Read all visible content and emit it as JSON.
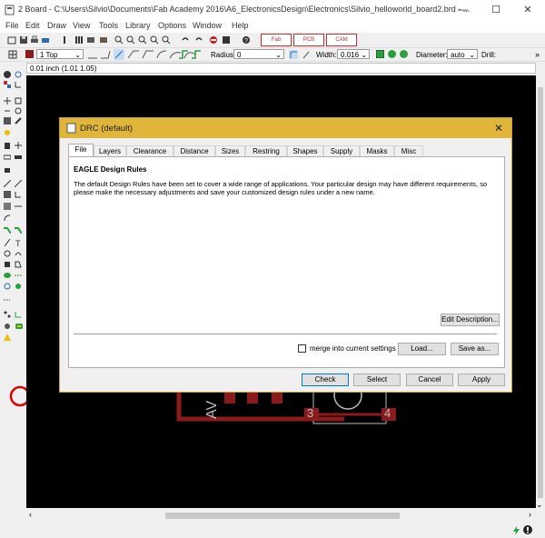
{
  "window": {
    "title": "2 Board - C:\\Users\\Silvio\\Documents\\Fab Academy 2016\\A6_ElectronicsDesign\\Electronics\\Silvio_helloworld_board2.brd - ...",
    "minimize": "—",
    "maximize": "☐",
    "close": "✕"
  },
  "menu": [
    "File",
    "Edit",
    "Draw",
    "View",
    "Tools",
    "Library",
    "Options",
    "Window",
    "Help"
  ],
  "toolbar": {
    "layer": "1 Top",
    "radius_label": "Radius:",
    "radius_value": "0",
    "width_label": "Width:",
    "width_value": "0.016",
    "diameter_label": "Diameter:",
    "diameter_value": "auto",
    "drill_label": "Drill:",
    "fab_btn": "Fab",
    "cam_btn": "CAM",
    "pcb_btn": "PCB",
    "more": "»",
    "coords": "0.01 inch (1.01 1.05)"
  },
  "board": {
    "text_av": "AV",
    "pad_a": "3",
    "pad_b": "4"
  },
  "dialog": {
    "title": "DRC (default)",
    "close": "✕",
    "tabs": [
      "File",
      "Layers",
      "Clearance",
      "Distance",
      "Sizes",
      "Restring",
      "Shapes",
      "Supply",
      "Masks",
      "Misc"
    ],
    "heading": "EAGLE Design Rules",
    "body": "The default Design Rules have been set to cover a wide range of applications. Your particular design may have different requirements, so please make the necessary adjustments and save your customized design rules under a new name.",
    "edit_description": "Edit Description...",
    "merge_label": "merge into current settings",
    "load": "Load...",
    "save_as": "Save as...",
    "check": "Check",
    "select": "Select",
    "cancel": "Cancel",
    "apply": "Apply"
  },
  "colors": {
    "dialog_title": "#e0b63a",
    "trace": "#8b1a1a",
    "highlight_circle": "#e00000"
  }
}
